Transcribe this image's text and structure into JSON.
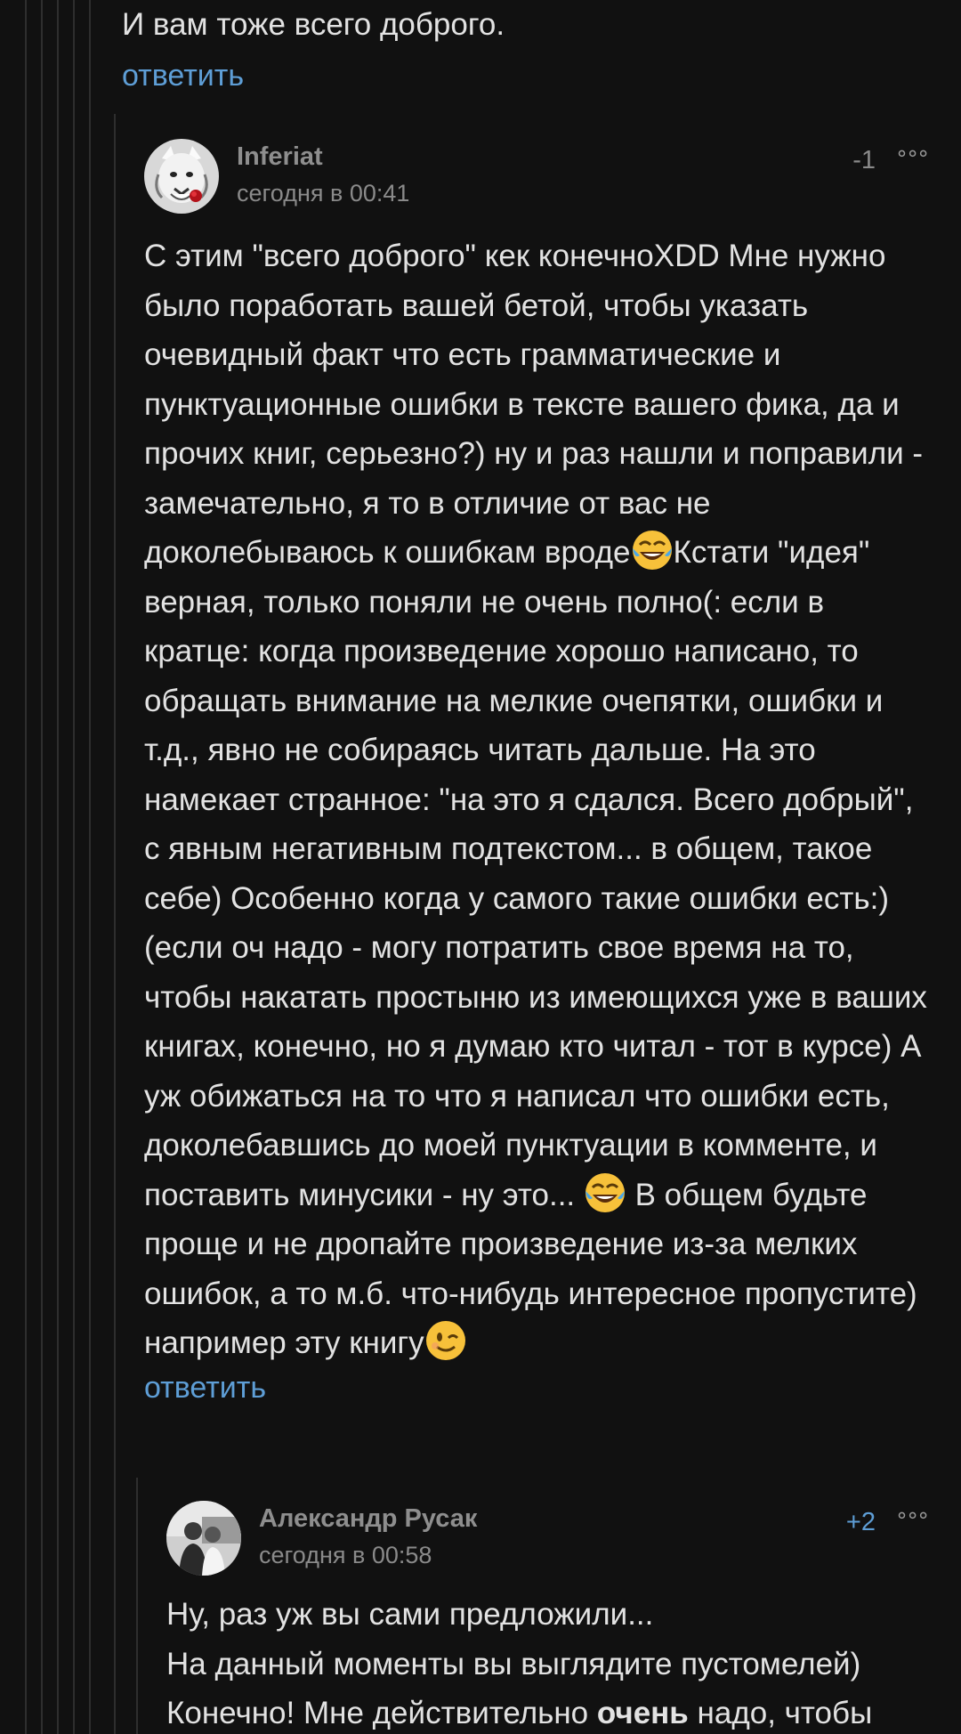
{
  "top_comment_tail": {
    "text": "И вам тоже всего доброго.",
    "reply_label": "ответить"
  },
  "comments": [
    {
      "author": "Inferiat",
      "time": "сегодня в 00:41",
      "rating": "-1",
      "rating_color": "#8a8a8a",
      "more_label": "∘∘∘",
      "body_parts": [
        "С этим \"всего доброго\" кек конечноXDD Мне нужно было поработать вашей бетой, чтобы указать очевидный факт что есть грамматические и пунктуационные ошибки в тексте вашего фика, да и прочих книг, серьезно?) ну и раз нашли и поправили - замечательно, я то в отличие от вас не доколебываюсь к ошибкам вроде",
        "Кстати \"идея\" верная, только поняли не очень полно(: если в кратце: когда произведение хорошо написано, то обращать внимание на мелкие очепятки, ошибки и т.д., явно не собираясь читать дальше. На это намекает странное:  \"на это я сдался. Всего добрый\", с явным негативным подтекстом... в общем, такое себе) Особенно когда у самого такие ошибки есть:) (если оч надо - могу потратить свое время на то, чтобы накатать простыню из имеющихся уже в ваших книгах, конечно, но я думаю кто читал - тот в курсе) А уж обижаться на то что я написал что ошибки есть, доколебавшись до моей пунктуации в комменте, и поставить минусики - ну это... ",
        " В общем будьте проще и не дропайте произведение из-за мелких ошибок, а то м.б. что-нибудь интересное пропустите) например эту книгу"
      ],
      "emojis": [
        "face-with-tears-of-joy-icon",
        "face-with-tears-of-joy-icon",
        "winking-face-icon"
      ],
      "reply_label": "ответить"
    },
    {
      "author": "Александр Русак",
      "time": "сегодня в 00:58",
      "rating": "+2",
      "rating_color": "#5e9ed6",
      "more_label": "∘∘∘",
      "body_line1": "Ну, раз уж вы сами предложили...",
      "body_line2": "На данный моменты вы выглядите пустомелей)",
      "body_line3_pre": "Конечно! Мне действительно ",
      "body_line3_bold": "очень",
      "body_line3_post": " надо, чтобы"
    }
  ],
  "colors": {
    "background": "#111111",
    "text": "#e2e2e2",
    "link": "#5e9ed6",
    "muted": "#8a8a8a",
    "thread_line": "#2e2e2e"
  }
}
